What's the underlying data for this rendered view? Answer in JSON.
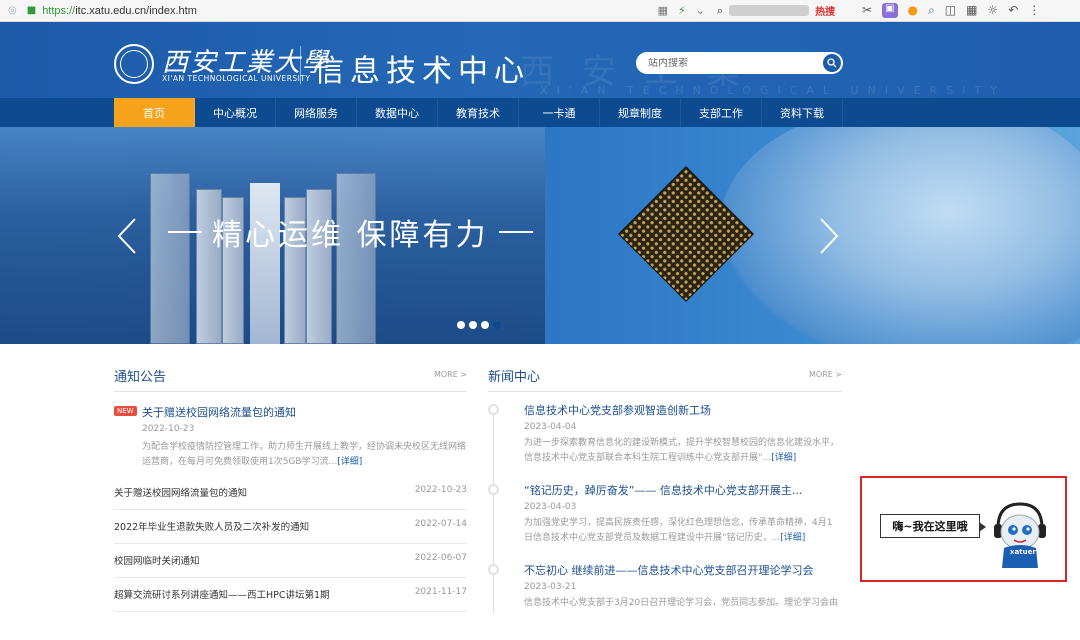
{
  "browser": {
    "url_scheme": "https://",
    "url_rest": "itc.xatu.edu.cn/index.htm",
    "hot_label": "热搜"
  },
  "header": {
    "school_name_cn": "西安工業大學",
    "school_name_en": "XI'AN TECHNOLOGICAL UNIVERSITY",
    "site_title": "信息技术中心",
    "search_placeholder": "站内搜索"
  },
  "nav": {
    "items": [
      {
        "label": "首页",
        "active": true
      },
      {
        "label": "中心概况"
      },
      {
        "label": "网络服务"
      },
      {
        "label": "数据中心"
      },
      {
        "label": "教育技术"
      },
      {
        "label": "一卡通"
      },
      {
        "label": "规章制度"
      },
      {
        "label": "支部工作"
      },
      {
        "label": "资料下载"
      }
    ]
  },
  "banner": {
    "slogan": "精心运维 保障有力",
    "slide_count": 4,
    "active_slide": 4
  },
  "notices": {
    "title": "通知公告",
    "more": "MORE >",
    "featured": {
      "badge": "NEW",
      "title": "关于赠送校园网络流量包的通知",
      "date": "2022-10-23",
      "summary": "为配合学校疫情防控管理工作，助力师生开展线上教学，经协调未央校区无线网络运营商，在每月可免费领取使用1次5GB学习流...",
      "more_link": "[详细]"
    },
    "items": [
      {
        "title": "关于赠送校园网络流量包的通知",
        "date": "2022-10-23"
      },
      {
        "title": "2022年毕业生退款失败人员及二次补发的通知",
        "date": "2022-07-14"
      },
      {
        "title": "校园网临时关闭通知",
        "date": "2022-06-07"
      },
      {
        "title": "超算交流研讨系列讲座通知——西工HPC讲坛第1期",
        "date": "2021-11-17"
      }
    ]
  },
  "news": {
    "title": "新闻中心",
    "more": "MORE >",
    "items": [
      {
        "title": "信息技术中心党支部参观智造创新工场",
        "date": "2023-04-04",
        "summary": "为进一步探索教育信息化的建设新模式，提升学校智慧校园的信息化建设水平，信息技术中心党支部联合本科生院工程训练中心党支部开展“...",
        "more_link": "[详细]"
      },
      {
        "title": "“铭记历史，踔厉奋发”—— 信息技术中心党支部开展主...",
        "date": "2023-04-03",
        "summary": "为加强党史学习，提高民族责任感，深化红色理想信念，传承革命精神，4月1日信息技术中心党支部党员及数据工程建设中开展“铭记历史，...",
        "more_link": "[详细]"
      },
      {
        "title": "不忘初心 继续前进——信息技术中心党支部召开理论学习会",
        "date": "2023-03-21",
        "summary": "信息技术中心党支部于3月20日召开理论学习会，党员同志参加。理论学习会由",
        "more_link": ""
      }
    ]
  },
  "mascot": {
    "bubble_text": "嗨~我在这里哦",
    "label": "xatuer"
  }
}
